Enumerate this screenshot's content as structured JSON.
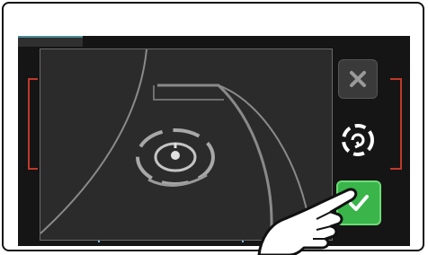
{
  "screen": {
    "buttons": {
      "cancel_icon": "close-icon",
      "rotate_icon": "rotate-icon",
      "confirm_icon": "checkmark-icon"
    },
    "colors": {
      "confirm_green": "#39b54a",
      "screen_bg": "#151515",
      "camera_bg": "#2b2b2b",
      "bracket_red": "#c0392b"
    }
  }
}
